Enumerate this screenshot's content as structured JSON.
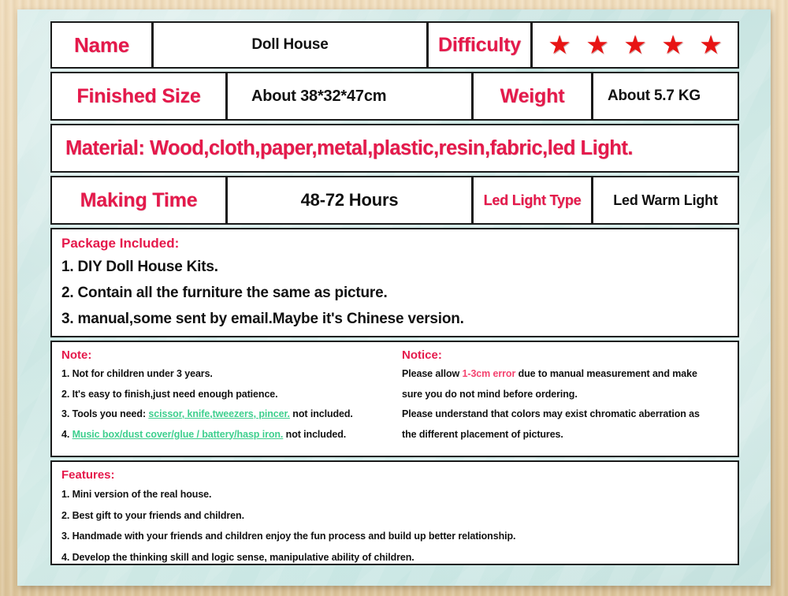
{
  "spec_rows": {
    "name_label": "Name",
    "name_value": "Doll House",
    "difficulty_label": "Difficulty",
    "difficulty_stars": 5,
    "difficulty_star_glyph": "★",
    "finished_size_label": "Finished Size",
    "finished_size_value": "About 38*32*47cm",
    "weight_label": "Weight",
    "weight_value": "About 5.7 KG",
    "material_line": "Material: Wood,cloth,paper,metal,plastic,resin,fabric,led Light.",
    "making_time_label": "Making Time",
    "making_time_value": "48-72 Hours",
    "led_light_type_label": "Led Light Type",
    "led_light_type_value": "Led Warm Light"
  },
  "package": {
    "title": "Package Included:",
    "items": [
      "1. DIY Doll House Kits.",
      "2. Contain all the furniture the same as picture.",
      "3. manual,some sent by email.Maybe it's Chinese version."
    ]
  },
  "note": {
    "title": "Note:",
    "item1": "1. Not for children under 3 years.",
    "item2": "2. It's easy to finish,just need enough patience.",
    "item3_prefix": "3. Tools you need: ",
    "item3_green": "scissor, knife,tweezers, pincer.",
    "item3_suffix": " not included.",
    "item4_prefix": "4. ",
    "item4_green": "Music box/dust cover/glue / battery/hasp iron.",
    "item4_suffix": " not included."
  },
  "notice": {
    "title": "Notice:",
    "line1_prefix": "Please allow ",
    "line1_highlight": "1-3cm error",
    "line1_suffix": " due to manual measurement and make",
    "line2": "sure you do not mind before ordering.",
    "line3": "Please understand that colors may exist chromatic aberration as",
    "line4": "the different placement of pictures."
  },
  "features": {
    "title": "Features:",
    "items": [
      "1. Mini version of the real house.",
      "2. Best gift to your friends and children.",
      "3. Handmade with your friends and children enjoy the fun process and build up better relationship.",
      "4. Develop the thinking skill and logic sense, manipulative ability of children."
    ]
  },
  "colors": {
    "label_red": "#e5194b",
    "star_red": "#e81414",
    "green_highlight": "#3ecf8e",
    "pink_highlight": "#f4436f",
    "board_mint": "#cfe8e5",
    "frame_tan": "#e4cfa8",
    "border_black": "#1a1a1a"
  }
}
